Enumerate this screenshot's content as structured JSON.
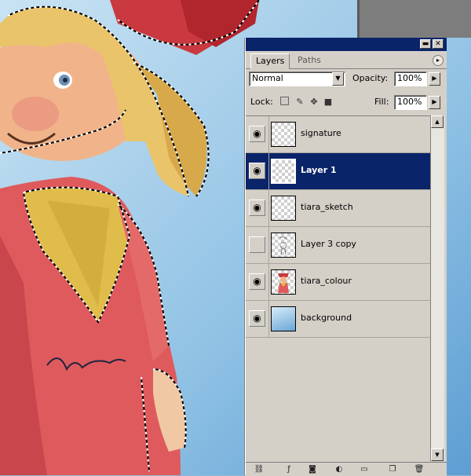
{
  "panel": {
    "minimize_glyph": "▬",
    "close_glyph": "✕",
    "tabs": [
      "Layers",
      "Paths"
    ],
    "menu_glyph": "▸"
  },
  "blend": {
    "mode": "Normal",
    "opacity_label": "Opacity:",
    "opacity_value": "100%"
  },
  "lock": {
    "label": "Lock:",
    "fill_label": "Fill:",
    "fill_value": "100%"
  },
  "layers": [
    {
      "name": "signature",
      "visible": true,
      "selected": false,
      "thumb": "transparent"
    },
    {
      "name": "Layer 1",
      "visible": true,
      "selected": true,
      "thumb": "transparent"
    },
    {
      "name": "tiara_sketch",
      "visible": true,
      "selected": false,
      "thumb": "transparent"
    },
    {
      "name": "Layer 3 copy",
      "visible": false,
      "selected": false,
      "thumb": "sketch"
    },
    {
      "name": "tiara_colour",
      "visible": true,
      "selected": false,
      "thumb": "colour"
    },
    {
      "name": "background",
      "visible": true,
      "selected": false,
      "thumb": "gradient"
    }
  ],
  "icons": {
    "eye": "eye-icon",
    "lock_transparent": "lock-transparent-icon",
    "lock_paint": "brush-icon",
    "lock_move": "move-icon",
    "lock_all": "lock-icon",
    "bottom": [
      "link-icon",
      "layer-style-icon",
      "mask-icon",
      "adjustment-icon",
      "folder-icon",
      "new-layer-icon",
      "trash-icon"
    ]
  },
  "colors": {
    "titlebar": "#0a246a",
    "selection": "#0a246a",
    "panel_bg": "#d4d0c8"
  }
}
